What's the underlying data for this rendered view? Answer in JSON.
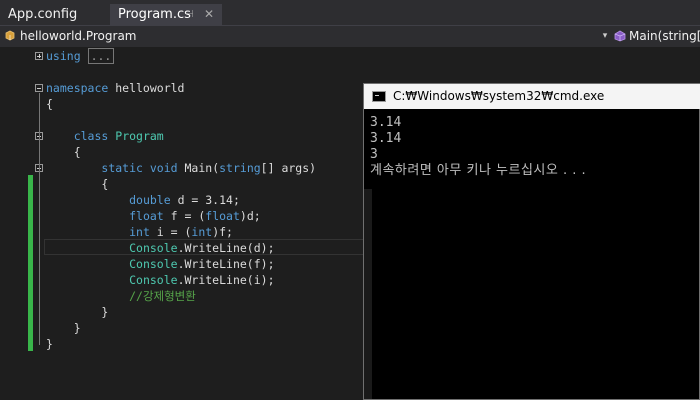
{
  "tabs": [
    {
      "label": "App.config",
      "active": false
    },
    {
      "label": "Program.cs",
      "active": true,
      "pin_icon": "pin-icon",
      "close_icon": "close-icon"
    }
  ],
  "nav": {
    "class_selector": "helloworld.Program",
    "member_selector": "Main(string[]",
    "dropdown_glyph": "▾"
  },
  "editor": {
    "collapsed_region": "...",
    "lines": {
      "using_kw": "using",
      "namespace_kw": "namespace",
      "namespace_name": " helloworld",
      "open_brace1": "{",
      "class_kw": "class",
      "class_name": "Program",
      "open_brace2": "{",
      "static_kw": "static",
      "void_kw": "void",
      "main_sig": " Main(",
      "string_kw": "string",
      "args": "[] args)",
      "open_brace3": "{",
      "double_kw": "double",
      "double_rest": " d = 3.14;",
      "float_kw": "float",
      "float_rest1": " f = (",
      "float_cast": "float",
      "float_rest2": ")d;",
      "int_kw": "int",
      "int_rest1": " i = (",
      "int_cast": "int",
      "int_rest2": ")f;",
      "console1_type": "Console",
      "console1_rest": ".WriteLine(d);",
      "console2_type": "Console",
      "console2_rest": ".WriteLine(f);",
      "console3_type": "Console",
      "console3_rest": ".WriteLine(i);",
      "comment": "//강제형변환",
      "close_brace3": "}",
      "close_brace2": "}",
      "close_brace1": "}"
    }
  },
  "console": {
    "title": "C:₩Windows₩system32₩cmd.exe",
    "output": [
      "3.14",
      "3.14",
      "3",
      "계속하려면 아무 키나 누르십시오 . . ."
    ]
  },
  "colors": {
    "keyword": "#569cd6",
    "type": "#4ec9b0",
    "comment": "#57a64a",
    "change_bar": "#39b54a"
  }
}
